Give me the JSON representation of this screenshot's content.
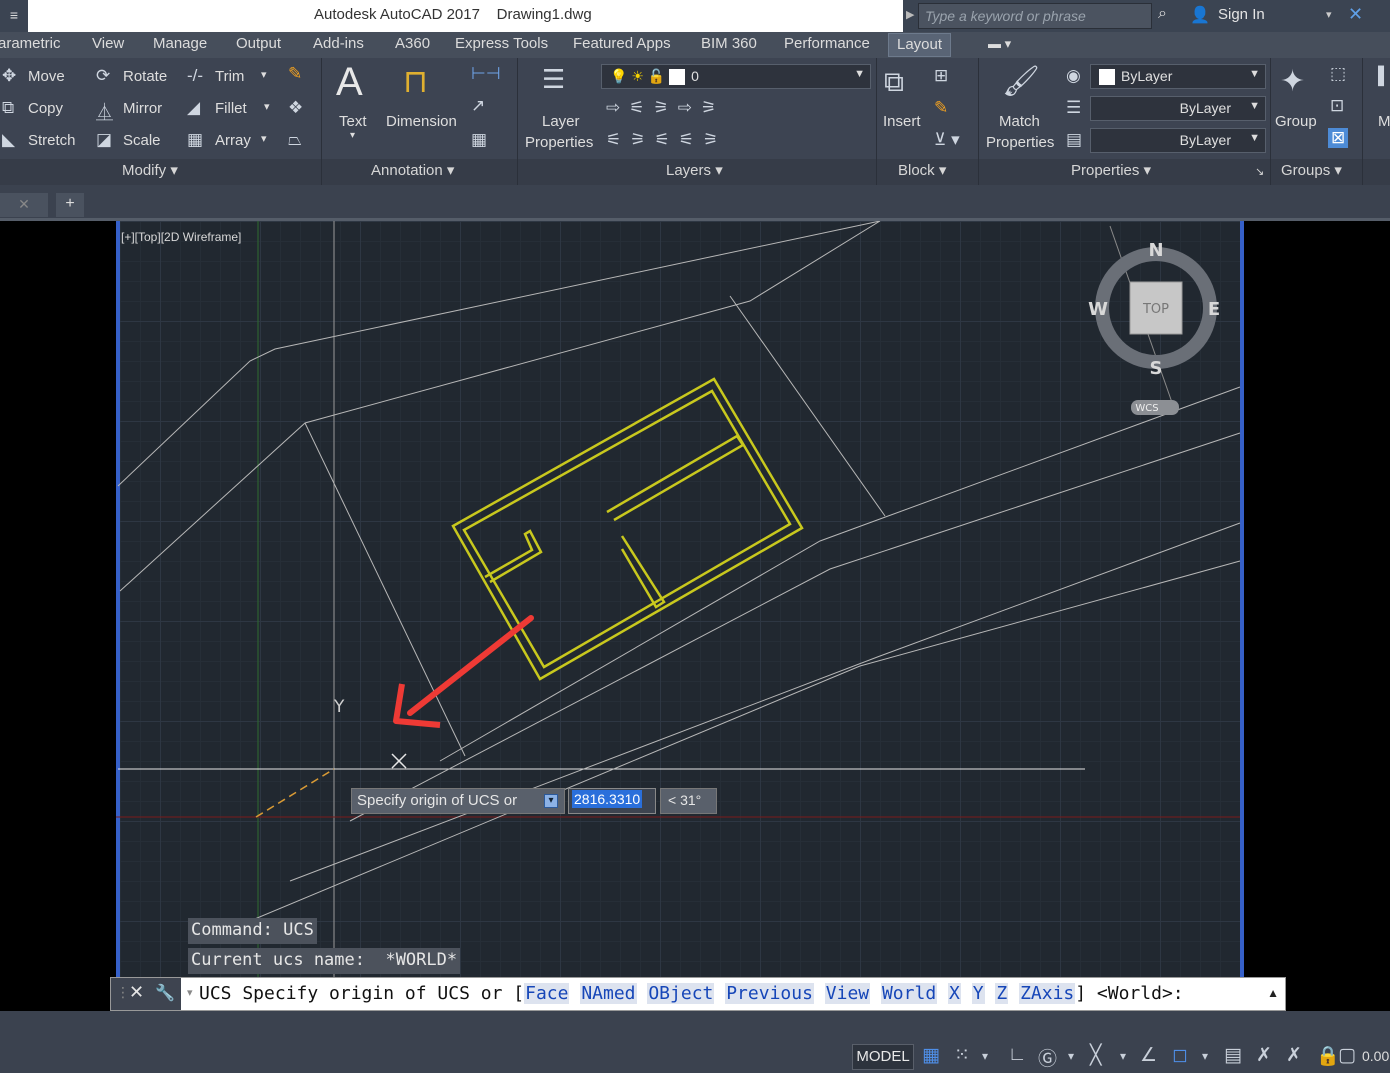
{
  "titlebar": {
    "app_title": "Autodesk AutoCAD 2017",
    "file_name": "Drawing1.dwg",
    "search_placeholder": "Type a keyword or phrase",
    "sign_in": "Sign In"
  },
  "tabs": [
    "arametric",
    "View",
    "Manage",
    "Output",
    "Add-ins",
    "A360",
    "Express Tools",
    "Featured Apps",
    "BIM 360",
    "Performance",
    "Layout"
  ],
  "ribbon": {
    "modify": {
      "move": "Move",
      "rotate": "Rotate",
      "trim": "Trim",
      "copy": "Copy",
      "mirror": "Mirror",
      "fillet": "Fillet",
      "stretch": "Stretch",
      "scale": "Scale",
      "array": "Array",
      "panel": "Modify"
    },
    "annotation": {
      "text": "Text",
      "dimension": "Dimension",
      "panel": "Annotation"
    },
    "layers": {
      "layer_properties_1": "Layer",
      "layer_properties_2": "Properties",
      "current_layer": "0",
      "panel": "Layers"
    },
    "block": {
      "insert": "Insert",
      "panel": "Block"
    },
    "properties": {
      "match_1": "Match",
      "match_2": "Properties",
      "color": "ByLayer",
      "linetype": "ByLayer",
      "lineweight": "ByLayer",
      "panel": "Properties"
    },
    "groups": {
      "group": "Group",
      "panel": "Groups"
    },
    "more": "M"
  },
  "viewport": {
    "label": "[+][Top][2D Wireframe]",
    "compass": {
      "n": "N",
      "s": "S",
      "e": "E",
      "w": "W",
      "top": "TOP",
      "wcs": "WCS"
    },
    "ucs_y": "Y"
  },
  "dynamic_input": {
    "prompt": "Specify origin of UCS or",
    "value": "2816.3310",
    "angle": "< 31°"
  },
  "command_history": [
    "Command: UCS",
    "Current ucs name:  *WORLD*"
  ],
  "command_line": {
    "prefix": "UCS Specify origin of UCS or [",
    "options": [
      "Face",
      "NAmed",
      "OBject",
      "Previous",
      "View",
      "World",
      "X",
      "Y",
      "Z",
      "ZAxis"
    ],
    "suffix": "] <World>:"
  },
  "statusbar": {
    "model": "MODEL",
    "coord": "0.00"
  },
  "colors": {
    "building": "#c8c81e",
    "arrow": "#ee3a35",
    "viewport_border": "#3660c9",
    "grid_bg": "#212830"
  }
}
